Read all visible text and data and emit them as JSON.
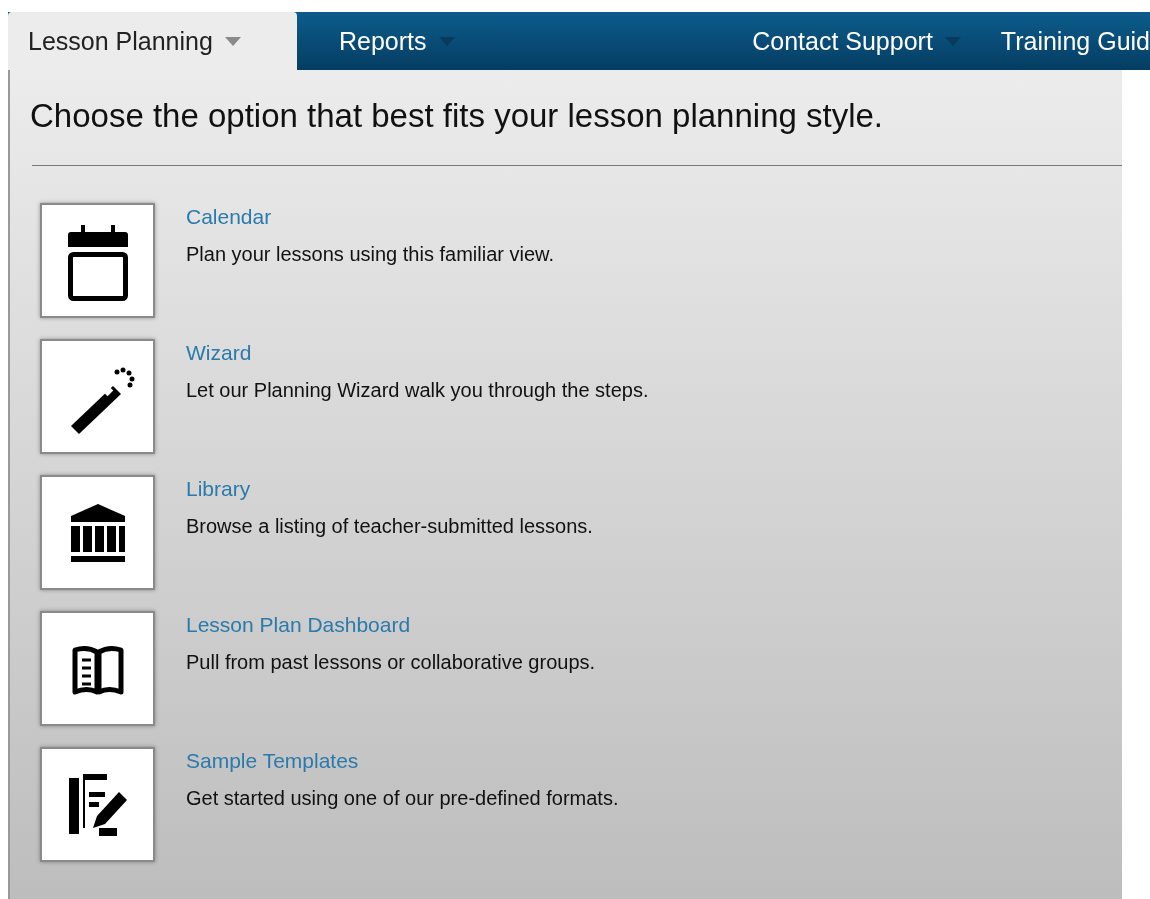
{
  "tabs": [
    {
      "label": "Lesson Planning",
      "selected": true
    },
    {
      "label": "Reports",
      "selected": false
    },
    {
      "label": "Contact Support",
      "selected": false
    },
    {
      "label": "Training Guid",
      "selected": false
    }
  ],
  "heading": "Choose the option that best fits your lesson planning style.",
  "options": [
    {
      "title": "Calendar",
      "description": "Plan your lessons using this familiar view."
    },
    {
      "title": "Wizard",
      "description": "Let our Planning Wizard walk you through the steps."
    },
    {
      "title": "Library",
      "description": "Browse a listing of teacher-submitted lessons."
    },
    {
      "title": "Lesson Plan Dashboard",
      "description": "Pull from past lessons or collaborative groups."
    },
    {
      "title": "Sample Templates",
      "description": "Get started using one of our pre-defined formats."
    }
  ]
}
